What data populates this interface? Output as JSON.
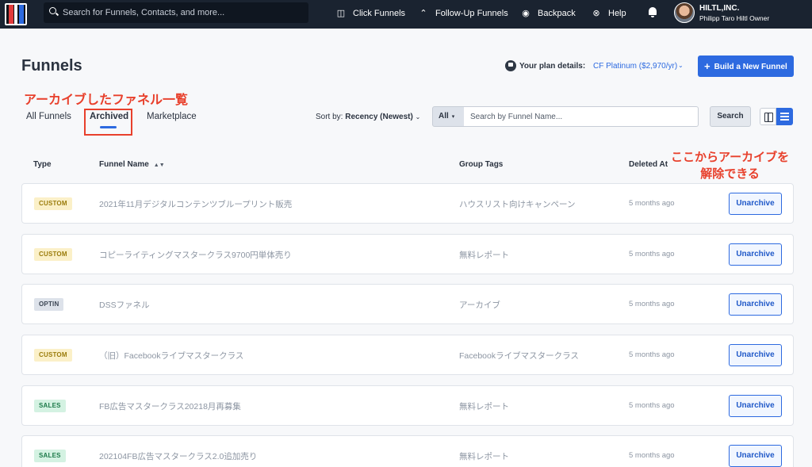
{
  "topnav": {
    "search_placeholder": "Search for Funnels, Contacts, and more...",
    "items": [
      {
        "label": "Click Funnels",
        "icon": "funnel-icon"
      },
      {
        "label": "Follow-Up Funnels",
        "icon": "chevrons-up-icon"
      },
      {
        "label": "Backpack",
        "icon": "backpack-icon"
      },
      {
        "label": "Help",
        "icon": "help-lifebuoy-icon"
      }
    ],
    "org": "HILTL,INC.",
    "user": "Philipp Taro Hiltl Owner"
  },
  "header": {
    "title": "Funnels",
    "plan_label": "Your plan details:",
    "plan_value": "CF Platinum ($2,970/yr)",
    "build_button": "Build a New Funnel"
  },
  "annotations": {
    "tab_note": "アーカイブしたファネル一覧",
    "unarchive_note_line1": "ここからアーカイブを",
    "unarchive_note_line2": "解除できる"
  },
  "tabs": [
    {
      "label": "All Funnels",
      "active": false
    },
    {
      "label": "Archived",
      "active": true
    },
    {
      "label": "Marketplace",
      "active": false
    }
  ],
  "toolbar": {
    "sort_prefix": "Sort by:",
    "sort_value": "Recency (Newest)",
    "filter_value": "All",
    "search_placeholder": "Search by Funnel Name...",
    "search_button": "Search"
  },
  "table": {
    "columns": [
      "Type",
      "Funnel Name",
      "Group Tags",
      "Deleted At"
    ],
    "action_label": "Unarchive",
    "rows": [
      {
        "type": "CUSTOM",
        "name": "2021年11月デジタルコンテンツブループリント販売",
        "tag": "ハウスリスト向けキャンペーン",
        "deleted": "5 months ago"
      },
      {
        "type": "CUSTOM",
        "name": "コピーライティングマスタークラス9700円単体売り",
        "tag": "無料レポート",
        "deleted": "5 months ago"
      },
      {
        "type": "OPTIN",
        "name": "DSSファネル",
        "tag": "アーカイブ",
        "deleted": "5 months ago"
      },
      {
        "type": "CUSTOM",
        "name": "（旧）Facebookライブマスタークラス",
        "tag": "Facebookライブマスタークラス",
        "deleted": "5 months ago"
      },
      {
        "type": "SALES",
        "name": "FB広告マスタークラス20218月再募集",
        "tag": "無料レポート",
        "deleted": "5 months ago"
      },
      {
        "type": "SALES",
        "name": "202104FB広告マスタークラス2.0追加売り",
        "tag": "無料レポート",
        "deleted": "5 months ago"
      }
    ]
  },
  "colors": {
    "accent": "#2d6ae0",
    "nav_bg": "#1a2330",
    "annotation": "#e8402c"
  }
}
